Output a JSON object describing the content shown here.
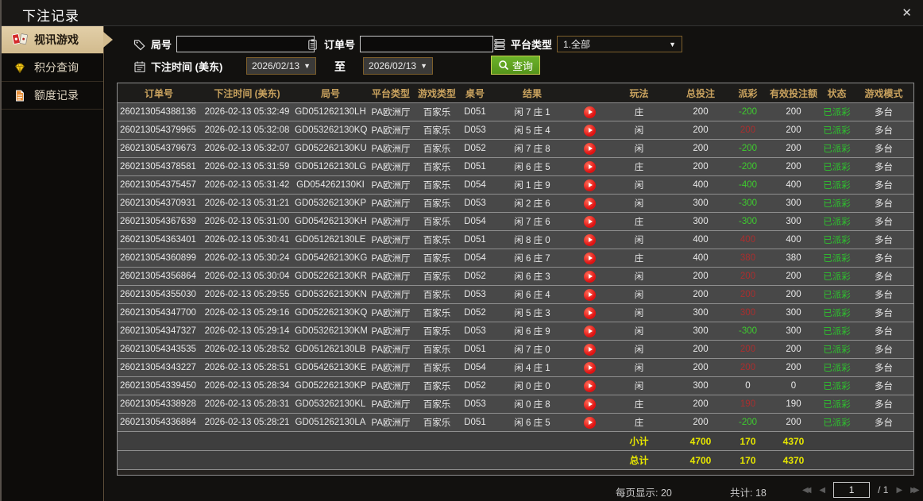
{
  "window": {
    "title": "下注记录",
    "close_glyph": "✕"
  },
  "sidebar": {
    "items": [
      {
        "label": "视讯游戏",
        "icon": "playing-cards-icon",
        "active": true
      },
      {
        "label": "积分查询",
        "icon": "gem-icon",
        "active": false
      },
      {
        "label": "额度记录",
        "icon": "document-icon",
        "active": false
      }
    ]
  },
  "filters": {
    "round_label": "局号",
    "round_value": "",
    "round_icon": "tag-icon",
    "order_label": "订单号",
    "order_value": "",
    "order_icon": "clipboard-icon",
    "platform_label": "平台类型",
    "platform_value": "1.全部",
    "platform_icon": "stack-icon",
    "time_label": "下注时间 (美东)",
    "time_icon": "calendar-icon",
    "date_from": "2026/02/13",
    "to_label": "至",
    "date_to": "2026/02/13",
    "caret_glyph": "▼",
    "search_label": "查询",
    "search_icon": "search-icon"
  },
  "table": {
    "columns": [
      "订单号",
      "下注时间 (美东)",
      "局号",
      "平台类型",
      "游戏类型",
      "桌号",
      "结果",
      "玩法",
      "总投注",
      "派彩",
      "有效投注额",
      "状态",
      "游戏模式"
    ],
    "rows": [
      {
        "order_id": "260213054388136",
        "time": "2026-02-13 05:32:49",
        "round": "GD051262130LH",
        "platform": "PA欧洲厅",
        "game": "百家乐",
        "table_no": "D051",
        "result": "闲 7 庄 1",
        "bet_on": "庄",
        "total_bet": "200",
        "payout": "-200",
        "valid_bet": "200",
        "status": "已派彩",
        "mode": "多台"
      },
      {
        "order_id": "260213054379965",
        "time": "2026-02-13 05:32:08",
        "round": "GD053262130KQ",
        "platform": "PA欧洲厅",
        "game": "百家乐",
        "table_no": "D053",
        "result": "闲 5 庄 4",
        "bet_on": "闲",
        "total_bet": "200",
        "payout": "200",
        "valid_bet": "200",
        "status": "已派彩",
        "mode": "多台"
      },
      {
        "order_id": "260213054379673",
        "time": "2026-02-13 05:32:07",
        "round": "GD052262130KU",
        "platform": "PA欧洲厅",
        "game": "百家乐",
        "table_no": "D052",
        "result": "闲 7 庄 8",
        "bet_on": "闲",
        "total_bet": "200",
        "payout": "-200",
        "valid_bet": "200",
        "status": "已派彩",
        "mode": "多台"
      },
      {
        "order_id": "260213054378581",
        "time": "2026-02-13 05:31:59",
        "round": "GD051262130LG",
        "platform": "PA欧洲厅",
        "game": "百家乐",
        "table_no": "D051",
        "result": "闲 6 庄 5",
        "bet_on": "庄",
        "total_bet": "200",
        "payout": "-200",
        "valid_bet": "200",
        "status": "已派彩",
        "mode": "多台"
      },
      {
        "order_id": "260213054375457",
        "time": "2026-02-13 05:31:42",
        "round": "GD054262130KI",
        "platform": "PA欧洲厅",
        "game": "百家乐",
        "table_no": "D054",
        "result": "闲 1 庄 9",
        "bet_on": "闲",
        "total_bet": "400",
        "payout": "-400",
        "valid_bet": "400",
        "status": "已派彩",
        "mode": "多台"
      },
      {
        "order_id": "260213054370931",
        "time": "2026-02-13 05:31:21",
        "round": "GD053262130KP",
        "platform": "PA欧洲厅",
        "game": "百家乐",
        "table_no": "D053",
        "result": "闲 2 庄 6",
        "bet_on": "闲",
        "total_bet": "300",
        "payout": "-300",
        "valid_bet": "300",
        "status": "已派彩",
        "mode": "多台"
      },
      {
        "order_id": "260213054367639",
        "time": "2026-02-13 05:31:00",
        "round": "GD054262130KH",
        "platform": "PA欧洲厅",
        "game": "百家乐",
        "table_no": "D054",
        "result": "闲 7 庄 6",
        "bet_on": "庄",
        "total_bet": "300",
        "payout": "-300",
        "valid_bet": "300",
        "status": "已派彩",
        "mode": "多台"
      },
      {
        "order_id": "260213054363401",
        "time": "2026-02-13 05:30:41",
        "round": "GD051262130LE",
        "platform": "PA欧洲厅",
        "game": "百家乐",
        "table_no": "D051",
        "result": "闲 8 庄 0",
        "bet_on": "闲",
        "total_bet": "400",
        "payout": "400",
        "valid_bet": "400",
        "status": "已派彩",
        "mode": "多台"
      },
      {
        "order_id": "260213054360899",
        "time": "2026-02-13 05:30:24",
        "round": "GD054262130KG",
        "platform": "PA欧洲厅",
        "game": "百家乐",
        "table_no": "D054",
        "result": "闲 6 庄 7",
        "bet_on": "庄",
        "total_bet": "400",
        "payout": "380",
        "valid_bet": "380",
        "status": "已派彩",
        "mode": "多台"
      },
      {
        "order_id": "260213054356864",
        "time": "2026-02-13 05:30:04",
        "round": "GD052262130KR",
        "platform": "PA欧洲厅",
        "game": "百家乐",
        "table_no": "D052",
        "result": "闲 6 庄 3",
        "bet_on": "闲",
        "total_bet": "200",
        "payout": "200",
        "valid_bet": "200",
        "status": "已派彩",
        "mode": "多台"
      },
      {
        "order_id": "260213054355030",
        "time": "2026-02-13 05:29:55",
        "round": "GD053262130KN",
        "platform": "PA欧洲厅",
        "game": "百家乐",
        "table_no": "D053",
        "result": "闲 6 庄 4",
        "bet_on": "闲",
        "total_bet": "200",
        "payout": "200",
        "valid_bet": "200",
        "status": "已派彩",
        "mode": "多台"
      },
      {
        "order_id": "260213054347700",
        "time": "2026-02-13 05:29:16",
        "round": "GD052262130KQ",
        "platform": "PA欧洲厅",
        "game": "百家乐",
        "table_no": "D052",
        "result": "闲 5 庄 3",
        "bet_on": "闲",
        "total_bet": "300",
        "payout": "300",
        "valid_bet": "300",
        "status": "已派彩",
        "mode": "多台"
      },
      {
        "order_id": "260213054347327",
        "time": "2026-02-13 05:29:14",
        "round": "GD053262130KM",
        "platform": "PA欧洲厅",
        "game": "百家乐",
        "table_no": "D053",
        "result": "闲 6 庄 9",
        "bet_on": "闲",
        "total_bet": "300",
        "payout": "-300",
        "valid_bet": "300",
        "status": "已派彩",
        "mode": "多台"
      },
      {
        "order_id": "260213054343535",
        "time": "2026-02-13 05:28:52",
        "round": "GD051262130LB",
        "platform": "PA欧洲厅",
        "game": "百家乐",
        "table_no": "D051",
        "result": "闲 7 庄 0",
        "bet_on": "闲",
        "total_bet": "200",
        "payout": "200",
        "valid_bet": "200",
        "status": "已派彩",
        "mode": "多台"
      },
      {
        "order_id": "260213054343227",
        "time": "2026-02-13 05:28:51",
        "round": "GD054262130KE",
        "platform": "PA欧洲厅",
        "game": "百家乐",
        "table_no": "D054",
        "result": "闲 4 庄 1",
        "bet_on": "闲",
        "total_bet": "200",
        "payout": "200",
        "valid_bet": "200",
        "status": "已派彩",
        "mode": "多台"
      },
      {
        "order_id": "260213054339450",
        "time": "2026-02-13 05:28:34",
        "round": "GD052262130KP",
        "platform": "PA欧洲厅",
        "game": "百家乐",
        "table_no": "D052",
        "result": "闲 0 庄 0",
        "bet_on": "闲",
        "total_bet": "300",
        "payout": "0",
        "valid_bet": "0",
        "status": "已派彩",
        "mode": "多台"
      },
      {
        "order_id": "260213054338928",
        "time": "2026-02-13 05:28:31",
        "round": "GD053262130KL",
        "platform": "PA欧洲厅",
        "game": "百家乐",
        "table_no": "D053",
        "result": "闲 0 庄 8",
        "bet_on": "庄",
        "total_bet": "200",
        "payout": "190",
        "valid_bet": "190",
        "status": "已派彩",
        "mode": "多台"
      },
      {
        "order_id": "260213054336884",
        "time": "2026-02-13 05:28:21",
        "round": "GD051262130LA",
        "platform": "PA欧洲厅",
        "game": "百家乐",
        "table_no": "D051",
        "result": "闲 6 庄 5",
        "bet_on": "庄",
        "total_bet": "200",
        "payout": "-200",
        "valid_bet": "200",
        "status": "已派彩",
        "mode": "多台"
      }
    ],
    "subtotal": {
      "label": "小计",
      "total_bet": "4700",
      "payout": "170",
      "valid_bet": "4370"
    },
    "grand_total": {
      "label": "总计",
      "total_bet": "4700",
      "payout": "170",
      "valid_bet": "4370"
    }
  },
  "footer": {
    "per_page": "每页显示: 20",
    "total_count": "共计: 18",
    "page": "1",
    "of_pages": "/  1",
    "first_glyph": "◀◀",
    "prev_glyph": "◀",
    "next_glyph": "▶",
    "last_glyph": "▶▶"
  },
  "colors": {
    "accent_gold": "#c9a25e",
    "active_tab_bg": "#d2bb8e",
    "payout_positive": "#aa2e2e",
    "payout_negative": "#3ecc2e",
    "status_paid": "#2ec22e",
    "totals_yellow": "#e6e600",
    "search_button_green": "#55941b",
    "play_icon_red": "#e01212"
  }
}
